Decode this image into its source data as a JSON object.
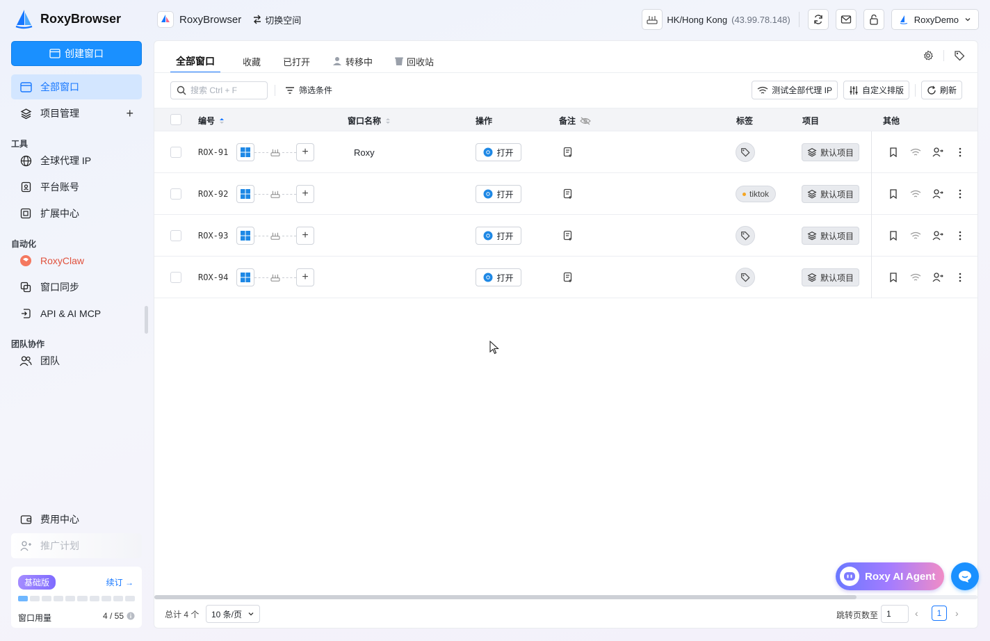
{
  "app": {
    "name": "RoxyBrowser"
  },
  "workspace": {
    "name": "RoxyBrowser",
    "switch_label": "切换空间"
  },
  "proxy": {
    "location": "HK/Hong Kong",
    "ip": "(43.99.78.148)"
  },
  "user": {
    "name": "RoxyDemo"
  },
  "sidebar": {
    "create_label": "创建窗口",
    "items": [
      {
        "label": "全部窗口"
      },
      {
        "label": "项目管理"
      }
    ],
    "sections": {
      "tools": "工具",
      "automation": "自动化",
      "team": "团队协作"
    },
    "tools": [
      {
        "label": "全球代理 IP"
      },
      {
        "label": "平台账号"
      },
      {
        "label": "扩展中心"
      }
    ],
    "automation": [
      {
        "label": "RoxyClaw"
      },
      {
        "label": "窗口同步"
      },
      {
        "label": "API & AI MCP"
      }
    ],
    "team": [
      {
        "label": "团队"
      }
    ],
    "bottom": [
      {
        "label": "费用中心"
      },
      {
        "label": "推广计划"
      }
    ],
    "plan": {
      "badge": "基础版",
      "renew": "续订",
      "usage_label": "窗口用量",
      "usage_value": "4 / 55",
      "usage_fraction": 0.07
    }
  },
  "tabs": [
    {
      "label": "全部窗口"
    },
    {
      "label": "收藏"
    },
    {
      "label": "已打开"
    },
    {
      "label": "转移中"
    },
    {
      "label": "回收站"
    }
  ],
  "toolbar": {
    "search_placeholder": "搜索 Ctrl + F",
    "filter_label": "筛选条件",
    "test_proxy_label": "测试全部代理 IP",
    "custom_sort_label": "自定义排版",
    "refresh_label": "刷新"
  },
  "table": {
    "columns": {
      "code": "编号",
      "name": "窗口名称",
      "action": "操作",
      "note": "备注",
      "tag": "标签",
      "project": "项目",
      "other": "其他"
    },
    "open_label": "打开",
    "rows": [
      {
        "code": "ROX-91",
        "name": "Roxy",
        "tag": "",
        "project": "默认项目"
      },
      {
        "code": "ROX-92",
        "name": "",
        "tag": "tiktok",
        "project": "默认项目"
      },
      {
        "code": "ROX-93",
        "name": "",
        "tag": "",
        "project": "默认项目"
      },
      {
        "code": "ROX-94",
        "name": "",
        "tag": "",
        "project": "默认项目"
      }
    ]
  },
  "pagination": {
    "total_label": "总计 4 个",
    "page_size": "10 条/页",
    "jump_label": "跳转页数至",
    "jump_value": "1",
    "current_page": "1"
  },
  "agent": {
    "label": "Roxy AI Agent"
  },
  "colors": {
    "accent": "#1677ff",
    "primary_button": "#1a90ff",
    "active_nav_bg": "#d3e6ff"
  }
}
